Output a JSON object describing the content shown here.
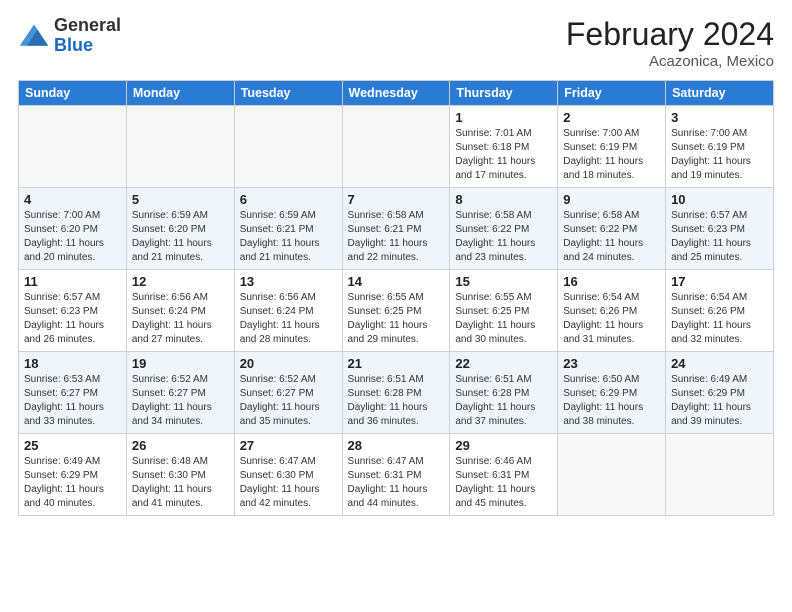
{
  "header": {
    "logo_general": "General",
    "logo_blue": "Blue",
    "month_title": "February 2024",
    "location": "Acazonica, Mexico"
  },
  "days_of_week": [
    "Sunday",
    "Monday",
    "Tuesday",
    "Wednesday",
    "Thursday",
    "Friday",
    "Saturday"
  ],
  "weeks": [
    [
      {
        "day": "",
        "info": ""
      },
      {
        "day": "",
        "info": ""
      },
      {
        "day": "",
        "info": ""
      },
      {
        "day": "",
        "info": ""
      },
      {
        "day": "1",
        "info": "Sunrise: 7:01 AM\nSunset: 6:18 PM\nDaylight: 11 hours\nand 17 minutes."
      },
      {
        "day": "2",
        "info": "Sunrise: 7:00 AM\nSunset: 6:19 PM\nDaylight: 11 hours\nand 18 minutes."
      },
      {
        "day": "3",
        "info": "Sunrise: 7:00 AM\nSunset: 6:19 PM\nDaylight: 11 hours\nand 19 minutes."
      }
    ],
    [
      {
        "day": "4",
        "info": "Sunrise: 7:00 AM\nSunset: 6:20 PM\nDaylight: 11 hours\nand 20 minutes."
      },
      {
        "day": "5",
        "info": "Sunrise: 6:59 AM\nSunset: 6:20 PM\nDaylight: 11 hours\nand 21 minutes."
      },
      {
        "day": "6",
        "info": "Sunrise: 6:59 AM\nSunset: 6:21 PM\nDaylight: 11 hours\nand 21 minutes."
      },
      {
        "day": "7",
        "info": "Sunrise: 6:58 AM\nSunset: 6:21 PM\nDaylight: 11 hours\nand 22 minutes."
      },
      {
        "day": "8",
        "info": "Sunrise: 6:58 AM\nSunset: 6:22 PM\nDaylight: 11 hours\nand 23 minutes."
      },
      {
        "day": "9",
        "info": "Sunrise: 6:58 AM\nSunset: 6:22 PM\nDaylight: 11 hours\nand 24 minutes."
      },
      {
        "day": "10",
        "info": "Sunrise: 6:57 AM\nSunset: 6:23 PM\nDaylight: 11 hours\nand 25 minutes."
      }
    ],
    [
      {
        "day": "11",
        "info": "Sunrise: 6:57 AM\nSunset: 6:23 PM\nDaylight: 11 hours\nand 26 minutes."
      },
      {
        "day": "12",
        "info": "Sunrise: 6:56 AM\nSunset: 6:24 PM\nDaylight: 11 hours\nand 27 minutes."
      },
      {
        "day": "13",
        "info": "Sunrise: 6:56 AM\nSunset: 6:24 PM\nDaylight: 11 hours\nand 28 minutes."
      },
      {
        "day": "14",
        "info": "Sunrise: 6:55 AM\nSunset: 6:25 PM\nDaylight: 11 hours\nand 29 minutes."
      },
      {
        "day": "15",
        "info": "Sunrise: 6:55 AM\nSunset: 6:25 PM\nDaylight: 11 hours\nand 30 minutes."
      },
      {
        "day": "16",
        "info": "Sunrise: 6:54 AM\nSunset: 6:26 PM\nDaylight: 11 hours\nand 31 minutes."
      },
      {
        "day": "17",
        "info": "Sunrise: 6:54 AM\nSunset: 6:26 PM\nDaylight: 11 hours\nand 32 minutes."
      }
    ],
    [
      {
        "day": "18",
        "info": "Sunrise: 6:53 AM\nSunset: 6:27 PM\nDaylight: 11 hours\nand 33 minutes."
      },
      {
        "day": "19",
        "info": "Sunrise: 6:52 AM\nSunset: 6:27 PM\nDaylight: 11 hours\nand 34 minutes."
      },
      {
        "day": "20",
        "info": "Sunrise: 6:52 AM\nSunset: 6:27 PM\nDaylight: 11 hours\nand 35 minutes."
      },
      {
        "day": "21",
        "info": "Sunrise: 6:51 AM\nSunset: 6:28 PM\nDaylight: 11 hours\nand 36 minutes."
      },
      {
        "day": "22",
        "info": "Sunrise: 6:51 AM\nSunset: 6:28 PM\nDaylight: 11 hours\nand 37 minutes."
      },
      {
        "day": "23",
        "info": "Sunrise: 6:50 AM\nSunset: 6:29 PM\nDaylight: 11 hours\nand 38 minutes."
      },
      {
        "day": "24",
        "info": "Sunrise: 6:49 AM\nSunset: 6:29 PM\nDaylight: 11 hours\nand 39 minutes."
      }
    ],
    [
      {
        "day": "25",
        "info": "Sunrise: 6:49 AM\nSunset: 6:29 PM\nDaylight: 11 hours\nand 40 minutes."
      },
      {
        "day": "26",
        "info": "Sunrise: 6:48 AM\nSunset: 6:30 PM\nDaylight: 11 hours\nand 41 minutes."
      },
      {
        "day": "27",
        "info": "Sunrise: 6:47 AM\nSunset: 6:30 PM\nDaylight: 11 hours\nand 42 minutes."
      },
      {
        "day": "28",
        "info": "Sunrise: 6:47 AM\nSunset: 6:31 PM\nDaylight: 11 hours\nand 44 minutes."
      },
      {
        "day": "29",
        "info": "Sunrise: 6:46 AM\nSunset: 6:31 PM\nDaylight: 11 hours\nand 45 minutes."
      },
      {
        "day": "",
        "info": ""
      },
      {
        "day": "",
        "info": ""
      }
    ]
  ]
}
